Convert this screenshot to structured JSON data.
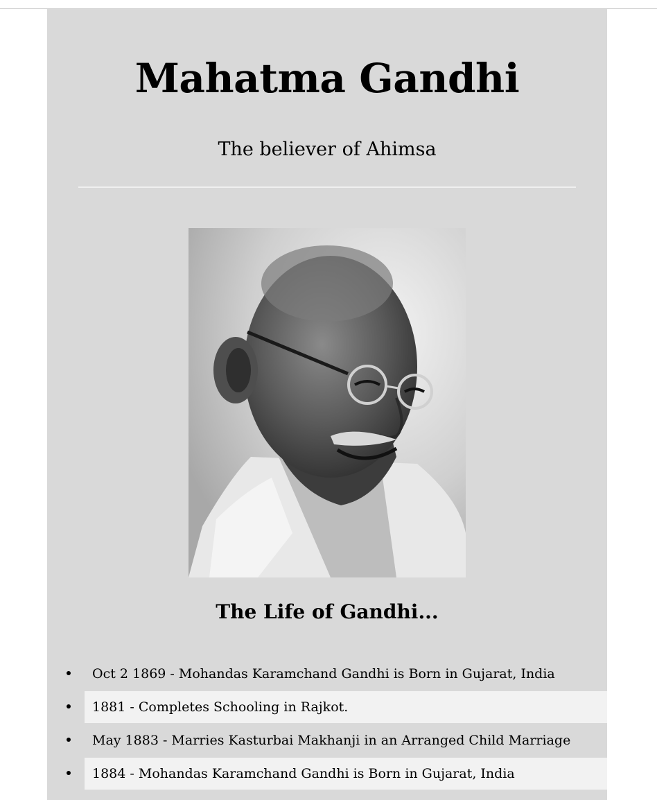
{
  "header": {
    "title": "Mahatma Gandhi",
    "subtitle": "The believer of Ahimsa"
  },
  "portrait": {
    "description": "image-gandhi-portrait"
  },
  "timeline": {
    "heading": "The Life of Gandhi...",
    "items": [
      {
        "date": "Oct 2 1869",
        "separator": " - ",
        "text": "Mohandas Karamchand Gandhi is Born in Gujarat, India"
      },
      {
        "date": "1881",
        "separator": " - ",
        "text": "Completes Schooling in Rajkot."
      },
      {
        "date": "May 1883",
        "separator": " - ",
        "text": "Marries Kasturbai Makhanji in an Arranged Child Marriage"
      },
      {
        "date": "1884",
        "separator": " - ",
        "text": "Mohandas Karamchand Gandhi is Born in Gujarat, India"
      }
    ]
  },
  "colors": {
    "page_background": "#ffffff",
    "main_background": "#d9d9d9",
    "alt_row": "#f2f2f2",
    "divider": "#f0f0f0"
  }
}
